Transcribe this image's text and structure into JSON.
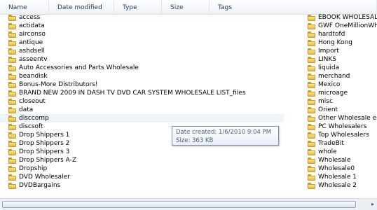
{
  "columns": [
    {
      "label": "Name",
      "width": 70
    },
    {
      "label": "Date modified",
      "width": 93
    },
    {
      "label": "Type",
      "width": 68
    },
    {
      "label": "Size",
      "width": 68
    },
    {
      "label": "Tags",
      "width": 239
    }
  ],
  "left_items": [
    "access",
    "actidata",
    "airconso",
    "antique",
    "ashdsell",
    "asseentv",
    "Auto Accessories and Parts Wholesale",
    "beandisk",
    "Bonus-More Distributors!",
    "BRAND NEW 2009 IN DASH TV DVD CAR SYSTEM WHOLESALE LIST_files",
    "closeout",
    "data",
    "disccomp",
    "discsoft",
    "Drop Shippers 1",
    "Drop Shippers 2",
    "Drop Shippers 3",
    "Drop Shippers A-Z",
    "Dropship",
    "DVD Wholesaler",
    "DVDBargains"
  ],
  "right_items": [
    "EBOOK WHOLESALER",
    "GWF OneMillionWho",
    "hardtofd",
    "Hong Kong",
    "Import",
    "LINKS",
    "liquida",
    "merchand",
    "Mexico",
    "microage",
    "misc",
    "Orient",
    "Other Wholesale eBo",
    "PC Wholesalers",
    "Top Wholesalers",
    "TradeBit",
    "whole",
    "Wholesale",
    "Wholesale0",
    "Wholesale 1",
    "Wholesale 2"
  ],
  "tooltip": {
    "line1": "Date created: 1/6/2010 9:04 PM",
    "line2": "Size: 363 KB"
  }
}
